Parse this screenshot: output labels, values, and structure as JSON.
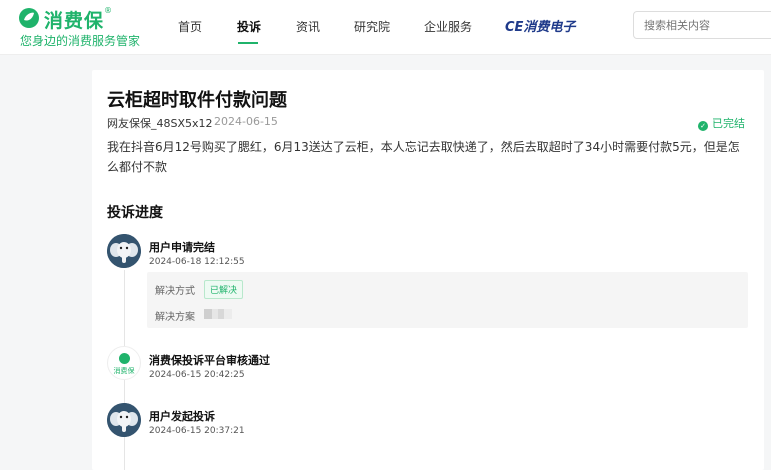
{
  "brand": {
    "name": "消费保",
    "reg_mark": "®",
    "tagline": "您身边的消费服务管家",
    "color": "#1fb36b"
  },
  "nav": {
    "items": [
      {
        "label": "首页",
        "active": false
      },
      {
        "label": "投诉",
        "active": true
      },
      {
        "label": "资讯",
        "active": false
      },
      {
        "label": "研究院",
        "active": false
      },
      {
        "label": "企业服务",
        "active": false
      }
    ],
    "ce_link": "CE消费电子"
  },
  "search": {
    "placeholder": "搜索相关内容"
  },
  "complaint": {
    "title": "云柜超时取件付款问题",
    "author": "网友保保_48SX5x12",
    "date": "2024-06-15",
    "status": "已完结",
    "status_icon": "check-circle-icon",
    "content": "我在抖音6月12号购买了腮红，6月13送达了云柜，本人忘记去取快递了，然后去取超时了34小时需要付款5元，但是怎么都付不款"
  },
  "progress": {
    "title": "投诉进度",
    "steps": [
      {
        "title": "用户申请完结",
        "time": "2024-06-18 12:12:55",
        "avatar": "elephant-avatar"
      },
      {
        "title": "消费保投诉平台审核通过",
        "time": "2024-06-15 20:42:25",
        "avatar": "xiaofeibao-logo"
      },
      {
        "title": "用户发起投诉",
        "time": "2024-06-15 20:37:21",
        "avatar": "elephant-avatar"
      }
    ],
    "resolution": {
      "method_label": "解决方式",
      "method_value": "已解决",
      "plan_label": "解决方案"
    },
    "platform_logo_text": "消费保"
  }
}
